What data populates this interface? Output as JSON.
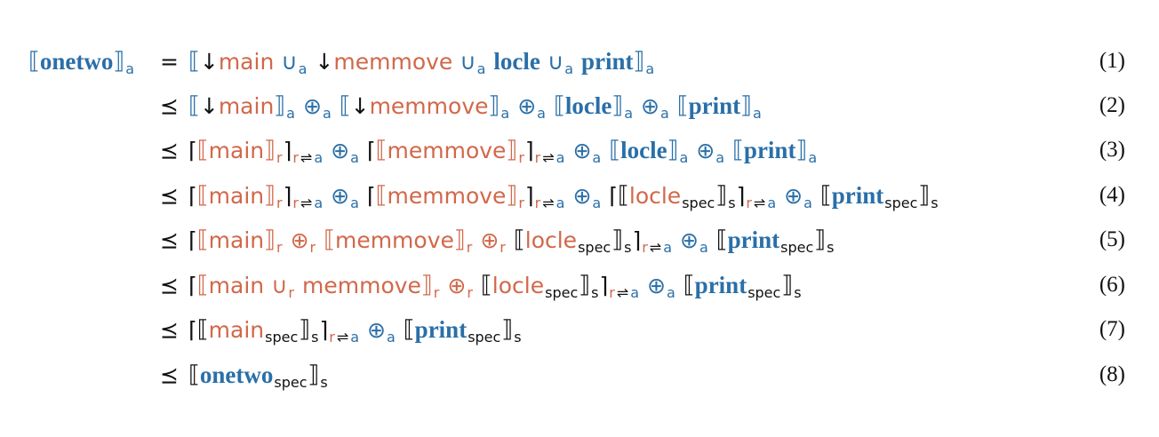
{
  "colors": {
    "blue": "#2a6fa8",
    "red": "#d2684a",
    "black": "#111111"
  },
  "lines": [
    {
      "rel": "=",
      "num": "(1)",
      "lhs": [
        {
          "t": "⟦",
          "c": "blue",
          "k": "br"
        },
        {
          "t": "onetwo",
          "c": "blue",
          "k": "b"
        },
        {
          "t": "⟧",
          "c": "blue",
          "k": "br"
        },
        {
          "t": "a",
          "c": "blue",
          "k": "sub"
        }
      ],
      "rhs": [
        {
          "t": "⟦",
          "c": "blue",
          "k": "br"
        },
        {
          "t": "↓",
          "c": "blk",
          "k": "s"
        },
        {
          "t": "main",
          "c": "red",
          "k": "s"
        },
        {
          "t": " ",
          "k": "sp"
        },
        {
          "t": "∪",
          "c": "blue",
          "k": "s"
        },
        {
          "t": "a",
          "c": "blue",
          "k": "sub"
        },
        {
          "t": " ",
          "k": "sp"
        },
        {
          "t": "↓",
          "c": "blk",
          "k": "s"
        },
        {
          "t": "memmove",
          "c": "red",
          "k": "s"
        },
        {
          "t": " ",
          "k": "sp"
        },
        {
          "t": "∪",
          "c": "blue",
          "k": "s"
        },
        {
          "t": "a",
          "c": "blue",
          "k": "sub"
        },
        {
          "t": " ",
          "k": "sp"
        },
        {
          "t": "locle",
          "c": "blue",
          "k": "b"
        },
        {
          "t": " ",
          "k": "sp"
        },
        {
          "t": "∪",
          "c": "blue",
          "k": "s"
        },
        {
          "t": "a",
          "c": "blue",
          "k": "sub"
        },
        {
          "t": " ",
          "k": "sp"
        },
        {
          "t": "print",
          "c": "blue",
          "k": "b"
        },
        {
          "t": "⟧",
          "c": "blue",
          "k": "br"
        },
        {
          "t": "a",
          "c": "blue",
          "k": "sub"
        }
      ]
    },
    {
      "rel": "⪯",
      "num": "(2)",
      "rhs": [
        {
          "t": "⟦",
          "c": "blue",
          "k": "br"
        },
        {
          "t": "↓",
          "c": "blk",
          "k": "s"
        },
        {
          "t": "main",
          "c": "red",
          "k": "s"
        },
        {
          "t": "⟧",
          "c": "blue",
          "k": "br"
        },
        {
          "t": "a",
          "c": "blue",
          "k": "sub"
        },
        {
          "t": " ",
          "k": "sp"
        },
        {
          "t": "⊕",
          "c": "blue",
          "k": "s"
        },
        {
          "t": "a",
          "c": "blue",
          "k": "sub"
        },
        {
          "t": " ",
          "k": "sp"
        },
        {
          "t": "⟦",
          "c": "blue",
          "k": "br"
        },
        {
          "t": "↓",
          "c": "blk",
          "k": "s"
        },
        {
          "t": "memmove",
          "c": "red",
          "k": "s"
        },
        {
          "t": "⟧",
          "c": "blue",
          "k": "br"
        },
        {
          "t": "a",
          "c": "blue",
          "k": "sub"
        },
        {
          "t": " ",
          "k": "sp"
        },
        {
          "t": "⊕",
          "c": "blue",
          "k": "s"
        },
        {
          "t": "a",
          "c": "blue",
          "k": "sub"
        },
        {
          "t": " ",
          "k": "sp"
        },
        {
          "t": "⟦",
          "c": "blue",
          "k": "br"
        },
        {
          "t": "locle",
          "c": "blue",
          "k": "b"
        },
        {
          "t": "⟧",
          "c": "blue",
          "k": "br"
        },
        {
          "t": "a",
          "c": "blue",
          "k": "sub"
        },
        {
          "t": " ",
          "k": "sp"
        },
        {
          "t": "⊕",
          "c": "blue",
          "k": "s"
        },
        {
          "t": "a",
          "c": "blue",
          "k": "sub"
        },
        {
          "t": " ",
          "k": "sp"
        },
        {
          "t": "⟦",
          "c": "blue",
          "k": "br"
        },
        {
          "t": "print",
          "c": "blue",
          "k": "b"
        },
        {
          "t": "⟧",
          "c": "blue",
          "k": "br"
        },
        {
          "t": "a",
          "c": "blue",
          "k": "sub"
        }
      ]
    },
    {
      "rel": "⪯",
      "num": "(3)",
      "rhs": [
        {
          "t": "⌈",
          "c": "blk",
          "k": "s"
        },
        {
          "t": "⟦",
          "c": "red",
          "k": "br"
        },
        {
          "t": "main",
          "c": "red",
          "k": "s"
        },
        {
          "t": "⟧",
          "c": "red",
          "k": "br"
        },
        {
          "t": "r",
          "c": "red",
          "k": "sub"
        },
        {
          "t": "⌉",
          "c": "blk",
          "k": "s"
        },
        {
          "t": "r",
          "c": "red",
          "k": "sub"
        },
        {
          "t": "⇌",
          "c": "blk",
          "k": "sub"
        },
        {
          "t": "a",
          "c": "blue",
          "k": "sub"
        },
        {
          "t": " ",
          "k": "sp"
        },
        {
          "t": "⊕",
          "c": "blue",
          "k": "s"
        },
        {
          "t": "a",
          "c": "blue",
          "k": "sub"
        },
        {
          "t": " ",
          "k": "sp"
        },
        {
          "t": "⌈",
          "c": "blk",
          "k": "s"
        },
        {
          "t": "⟦",
          "c": "red",
          "k": "br"
        },
        {
          "t": "memmove",
          "c": "red",
          "k": "s"
        },
        {
          "t": "⟧",
          "c": "red",
          "k": "br"
        },
        {
          "t": "r",
          "c": "red",
          "k": "sub"
        },
        {
          "t": "⌉",
          "c": "blk",
          "k": "s"
        },
        {
          "t": "r",
          "c": "red",
          "k": "sub"
        },
        {
          "t": "⇌",
          "c": "blk",
          "k": "sub"
        },
        {
          "t": "a",
          "c": "blue",
          "k": "sub"
        },
        {
          "t": " ",
          "k": "sp"
        },
        {
          "t": "⊕",
          "c": "blue",
          "k": "s"
        },
        {
          "t": "a",
          "c": "blue",
          "k": "sub"
        },
        {
          "t": " ",
          "k": "sp"
        },
        {
          "t": "⟦",
          "c": "blue",
          "k": "br"
        },
        {
          "t": "locle",
          "c": "blue",
          "k": "b"
        },
        {
          "t": "⟧",
          "c": "blue",
          "k": "br"
        },
        {
          "t": "a",
          "c": "blue",
          "k": "sub"
        },
        {
          "t": " ",
          "k": "sp"
        },
        {
          "t": "⊕",
          "c": "blue",
          "k": "s"
        },
        {
          "t": "a",
          "c": "blue",
          "k": "sub"
        },
        {
          "t": " ",
          "k": "sp"
        },
        {
          "t": "⟦",
          "c": "blue",
          "k": "br"
        },
        {
          "t": "print",
          "c": "blue",
          "k": "b"
        },
        {
          "t": "⟧",
          "c": "blue",
          "k": "br"
        },
        {
          "t": "a",
          "c": "blue",
          "k": "sub"
        }
      ]
    },
    {
      "rel": "⪯",
      "num": "(4)",
      "rhs": [
        {
          "t": "⌈",
          "c": "blk",
          "k": "s"
        },
        {
          "t": "⟦",
          "c": "red",
          "k": "br"
        },
        {
          "t": "main",
          "c": "red",
          "k": "s"
        },
        {
          "t": "⟧",
          "c": "red",
          "k": "br"
        },
        {
          "t": "r",
          "c": "red",
          "k": "sub"
        },
        {
          "t": "⌉",
          "c": "blk",
          "k": "s"
        },
        {
          "t": "r",
          "c": "red",
          "k": "sub"
        },
        {
          "t": "⇌",
          "c": "blk",
          "k": "sub"
        },
        {
          "t": "a",
          "c": "blue",
          "k": "sub"
        },
        {
          "t": " ",
          "k": "sp"
        },
        {
          "t": "⊕",
          "c": "blue",
          "k": "s"
        },
        {
          "t": "a",
          "c": "blue",
          "k": "sub"
        },
        {
          "t": " ",
          "k": "sp"
        },
        {
          "t": "⌈",
          "c": "blk",
          "k": "s"
        },
        {
          "t": "⟦",
          "c": "red",
          "k": "br"
        },
        {
          "t": "memmove",
          "c": "red",
          "k": "s"
        },
        {
          "t": "⟧",
          "c": "red",
          "k": "br"
        },
        {
          "t": "r",
          "c": "red",
          "k": "sub"
        },
        {
          "t": "⌉",
          "c": "blk",
          "k": "s"
        },
        {
          "t": "r",
          "c": "red",
          "k": "sub"
        },
        {
          "t": "⇌",
          "c": "blk",
          "k": "sub"
        },
        {
          "t": "a",
          "c": "blue",
          "k": "sub"
        },
        {
          "t": " ",
          "k": "sp"
        },
        {
          "t": "⊕",
          "c": "blue",
          "k": "s"
        },
        {
          "t": "a",
          "c": "blue",
          "k": "sub"
        },
        {
          "t": " ",
          "k": "sp"
        },
        {
          "t": "⌈",
          "c": "blk",
          "k": "s"
        },
        {
          "t": "⟦",
          "c": "blk",
          "k": "br"
        },
        {
          "t": "locle",
          "c": "red",
          "k": "s"
        },
        {
          "t": "spec",
          "c": "blk",
          "k": "sub"
        },
        {
          "t": "⟧",
          "c": "blk",
          "k": "br"
        },
        {
          "t": "s",
          "c": "blk",
          "k": "sub"
        },
        {
          "t": "⌉",
          "c": "blk",
          "k": "s"
        },
        {
          "t": "r",
          "c": "red",
          "k": "sub"
        },
        {
          "t": "⇌",
          "c": "blk",
          "k": "sub"
        },
        {
          "t": "a",
          "c": "blue",
          "k": "sub"
        },
        {
          "t": " ",
          "k": "sp"
        },
        {
          "t": "⊕",
          "c": "blue",
          "k": "s"
        },
        {
          "t": "a",
          "c": "blue",
          "k": "sub"
        },
        {
          "t": " ",
          "k": "sp"
        },
        {
          "t": "⟦",
          "c": "blk",
          "k": "br"
        },
        {
          "t": "print",
          "c": "blue",
          "k": "b"
        },
        {
          "t": "spec",
          "c": "blk",
          "k": "sub"
        },
        {
          "t": "⟧",
          "c": "blk",
          "k": "br"
        },
        {
          "t": "s",
          "c": "blk",
          "k": "sub"
        }
      ]
    },
    {
      "rel": "⪯",
      "num": "(5)",
      "rhs": [
        {
          "t": "⌈",
          "c": "blk",
          "k": "s"
        },
        {
          "t": "⟦",
          "c": "red",
          "k": "br"
        },
        {
          "t": "main",
          "c": "red",
          "k": "s"
        },
        {
          "t": "⟧",
          "c": "red",
          "k": "br"
        },
        {
          "t": "r",
          "c": "red",
          "k": "sub"
        },
        {
          "t": " ",
          "k": "sp"
        },
        {
          "t": "⊕",
          "c": "red",
          "k": "s"
        },
        {
          "t": "r",
          "c": "red",
          "k": "sub"
        },
        {
          "t": " ",
          "k": "sp"
        },
        {
          "t": "⟦",
          "c": "red",
          "k": "br"
        },
        {
          "t": "memmove",
          "c": "red",
          "k": "s"
        },
        {
          "t": "⟧",
          "c": "red",
          "k": "br"
        },
        {
          "t": "r",
          "c": "red",
          "k": "sub"
        },
        {
          "t": " ",
          "k": "sp"
        },
        {
          "t": "⊕",
          "c": "red",
          "k": "s"
        },
        {
          "t": "r",
          "c": "red",
          "k": "sub"
        },
        {
          "t": " ",
          "k": "sp"
        },
        {
          "t": "⟦",
          "c": "blk",
          "k": "br"
        },
        {
          "t": "locle",
          "c": "red",
          "k": "s"
        },
        {
          "t": "spec",
          "c": "blk",
          "k": "sub"
        },
        {
          "t": "⟧",
          "c": "blk",
          "k": "br"
        },
        {
          "t": "s",
          "c": "blk",
          "k": "sub"
        },
        {
          "t": "⌉",
          "c": "blk",
          "k": "s"
        },
        {
          "t": "r",
          "c": "red",
          "k": "sub"
        },
        {
          "t": "⇌",
          "c": "blk",
          "k": "sub"
        },
        {
          "t": "a",
          "c": "blue",
          "k": "sub"
        },
        {
          "t": " ",
          "k": "sp"
        },
        {
          "t": "⊕",
          "c": "blue",
          "k": "s"
        },
        {
          "t": "a",
          "c": "blue",
          "k": "sub"
        },
        {
          "t": " ",
          "k": "sp"
        },
        {
          "t": "⟦",
          "c": "blk",
          "k": "br"
        },
        {
          "t": "print",
          "c": "blue",
          "k": "b"
        },
        {
          "t": "spec",
          "c": "blk",
          "k": "sub"
        },
        {
          "t": "⟧",
          "c": "blk",
          "k": "br"
        },
        {
          "t": "s",
          "c": "blk",
          "k": "sub"
        }
      ]
    },
    {
      "rel": "⪯",
      "num": "(6)",
      "rhs": [
        {
          "t": "⌈",
          "c": "blk",
          "k": "s"
        },
        {
          "t": "⟦",
          "c": "red",
          "k": "br"
        },
        {
          "t": "main",
          "c": "red",
          "k": "s"
        },
        {
          "t": " ",
          "k": "sp"
        },
        {
          "t": "∪",
          "c": "red",
          "k": "s"
        },
        {
          "t": "r",
          "c": "red",
          "k": "sub"
        },
        {
          "t": " ",
          "k": "sp"
        },
        {
          "t": "memmove",
          "c": "red",
          "k": "s"
        },
        {
          "t": "⟧",
          "c": "red",
          "k": "br"
        },
        {
          "t": "r",
          "c": "red",
          "k": "sub"
        },
        {
          "t": " ",
          "k": "sp"
        },
        {
          "t": "⊕",
          "c": "red",
          "k": "s"
        },
        {
          "t": "r",
          "c": "red",
          "k": "sub"
        },
        {
          "t": " ",
          "k": "sp"
        },
        {
          "t": "⟦",
          "c": "blk",
          "k": "br"
        },
        {
          "t": "locle",
          "c": "red",
          "k": "s"
        },
        {
          "t": "spec",
          "c": "blk",
          "k": "sub"
        },
        {
          "t": "⟧",
          "c": "blk",
          "k": "br"
        },
        {
          "t": "s",
          "c": "blk",
          "k": "sub"
        },
        {
          "t": "⌉",
          "c": "blk",
          "k": "s"
        },
        {
          "t": "r",
          "c": "red",
          "k": "sub"
        },
        {
          "t": "⇌",
          "c": "blk",
          "k": "sub"
        },
        {
          "t": "a",
          "c": "blue",
          "k": "sub"
        },
        {
          "t": " ",
          "k": "sp"
        },
        {
          "t": "⊕",
          "c": "blue",
          "k": "s"
        },
        {
          "t": "a",
          "c": "blue",
          "k": "sub"
        },
        {
          "t": " ",
          "k": "sp"
        },
        {
          "t": "⟦",
          "c": "blk",
          "k": "br"
        },
        {
          "t": "print",
          "c": "blue",
          "k": "b"
        },
        {
          "t": "spec",
          "c": "blk",
          "k": "sub"
        },
        {
          "t": "⟧",
          "c": "blk",
          "k": "br"
        },
        {
          "t": "s",
          "c": "blk",
          "k": "sub"
        }
      ]
    },
    {
      "rel": "⪯",
      "num": "(7)",
      "rhs": [
        {
          "t": "⌈",
          "c": "blk",
          "k": "s"
        },
        {
          "t": "⟦",
          "c": "blk",
          "k": "br"
        },
        {
          "t": "main",
          "c": "red",
          "k": "s"
        },
        {
          "t": "spec",
          "c": "blk",
          "k": "sub"
        },
        {
          "t": "⟧",
          "c": "blk",
          "k": "br"
        },
        {
          "t": "s",
          "c": "blk",
          "k": "sub"
        },
        {
          "t": "⌉",
          "c": "blk",
          "k": "s"
        },
        {
          "t": "r",
          "c": "red",
          "k": "sub"
        },
        {
          "t": "⇌",
          "c": "blk",
          "k": "sub"
        },
        {
          "t": "a",
          "c": "blue",
          "k": "sub"
        },
        {
          "t": " ",
          "k": "sp"
        },
        {
          "t": "⊕",
          "c": "blue",
          "k": "s"
        },
        {
          "t": "a",
          "c": "blue",
          "k": "sub"
        },
        {
          "t": " ",
          "k": "sp"
        },
        {
          "t": "⟦",
          "c": "blk",
          "k": "br"
        },
        {
          "t": "print",
          "c": "blue",
          "k": "b"
        },
        {
          "t": "spec",
          "c": "blk",
          "k": "sub"
        },
        {
          "t": "⟧",
          "c": "blk",
          "k": "br"
        },
        {
          "t": "s",
          "c": "blk",
          "k": "sub"
        }
      ]
    },
    {
      "rel": "⪯",
      "num": "(8)",
      "rhs": [
        {
          "t": "⟦",
          "c": "blk",
          "k": "br"
        },
        {
          "t": "onetwo",
          "c": "blue",
          "k": "b"
        },
        {
          "t": "spec",
          "c": "blk",
          "k": "sub"
        },
        {
          "t": "⟧",
          "c": "blk",
          "k": "br"
        },
        {
          "t": "s",
          "c": "blk",
          "k": "sub"
        }
      ]
    }
  ]
}
